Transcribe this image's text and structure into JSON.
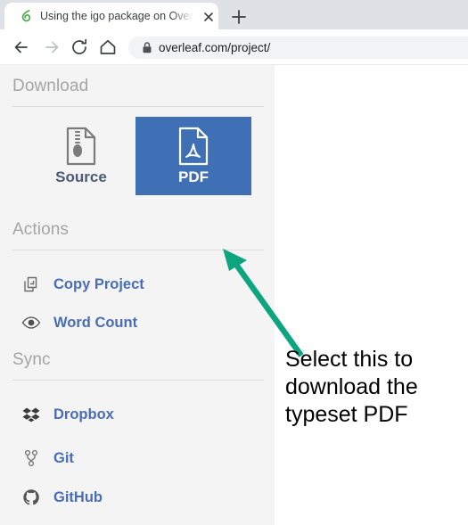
{
  "browser": {
    "tab": {
      "favicon": "overleaf-logo-icon",
      "title": "Using the igo package on Overle",
      "close_icon": "close-icon"
    },
    "new_tab_icon": "plus-icon",
    "nav": {
      "back_icon": "back-arrow-icon",
      "forward_icon": "forward-arrow-icon",
      "reload_icon": "reload-icon",
      "home_icon": "home-icon"
    },
    "omnibox": {
      "lock_icon": "lock-icon",
      "url": "overleaf.com/project/"
    }
  },
  "sidebar": {
    "sections": [
      {
        "id": "download",
        "title": "Download",
        "buttons": [
          {
            "id": "source",
            "label": "Source",
            "icon": "zip-file-icon",
            "selected": false
          },
          {
            "id": "pdf",
            "label": "PDF",
            "icon": "pdf-file-icon",
            "selected": true
          }
        ]
      },
      {
        "id": "actions",
        "title": "Actions",
        "items": [
          {
            "id": "copy-project",
            "label": "Copy Project",
            "icon": "copy-icon"
          },
          {
            "id": "word-count",
            "label": "Word Count",
            "icon": "eye-icon"
          }
        ]
      },
      {
        "id": "sync",
        "title": "Sync",
        "items": [
          {
            "id": "dropbox",
            "label": "Dropbox",
            "icon": "dropbox-icon"
          },
          {
            "id": "git",
            "label": "Git",
            "icon": "git-branch-icon"
          },
          {
            "id": "github",
            "label": "GitHub",
            "icon": "github-icon"
          }
        ]
      }
    ]
  },
  "annotation": {
    "arrow_icon": "green-arrow-icon",
    "lines": [
      "Select this to",
      "download the",
      "typeset PDF"
    ]
  },
  "colors": {
    "pdf_button_blue": "#3f70b5",
    "link_blue": "#4a6db4",
    "section_title_gray": "#a5a5a5",
    "sidebar_bg": "#f4f4f4",
    "annotation_green": "#0da57f",
    "tabstrip_bg": "#dee1e6"
  }
}
